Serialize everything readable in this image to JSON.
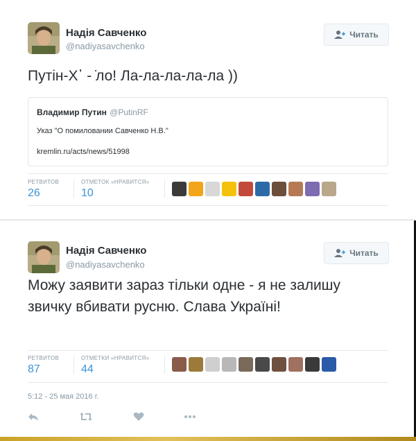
{
  "tweets": [
    {
      "author_name": "Надія Савченко",
      "author_handle": "@nadiyasavchenko",
      "follow_label": "Читать",
      "text": "Путін-Х᾿ - ̇ло! Ла-ла-ла-ла-ла ))",
      "quote": {
        "author_name": "Владимир Путин",
        "author_handle": "@PutinRF",
        "text": "Указ \"О помиловании Савченко Н.В.\"",
        "link": "kremlin.ru/acts/news/51998"
      },
      "retweets_label": "РЕТВИТОВ",
      "retweets": "26",
      "likes_label": "ОТМЕТОК «НРАВИТСЯ»",
      "likes": "10",
      "liker_colors": [
        "#3a3a3a",
        "#f2a51a",
        "#d8d8d8",
        "#f4c20d",
        "#c24a3b",
        "#2d6aa8",
        "#6b4f3a",
        "#b57a54",
        "#7e6bb2",
        "#b8a78a"
      ]
    },
    {
      "author_name": "Надія Савченко",
      "author_handle": "@nadiyasavchenko",
      "follow_label": "Читать",
      "text": "Можу заявити зараз тільки одне - я не залишу звичку вбивати русню. Слава Україні!",
      "retweets_label": "РЕТВИТОВ",
      "retweets": "87",
      "likes_label": "ОТМЕТКИ «НРАВИТСЯ»",
      "likes": "44",
      "liker_colors": [
        "#8a5a4a",
        "#9b7a3a",
        "#cfcfcf",
        "#b8b8b8",
        "#7a6a5a",
        "#4a4a4a",
        "#6e5040",
        "#a07060",
        "#3a3a3a",
        "#2a5aa8"
      ],
      "timestamp": "5:12 - 25 мая 2016 г."
    }
  ],
  "accent_color": "#3b94d9",
  "icons": [
    "follow-person-plus-icon",
    "reply-icon",
    "retweet-icon",
    "like-heart-icon",
    "more-dots-icon"
  ]
}
